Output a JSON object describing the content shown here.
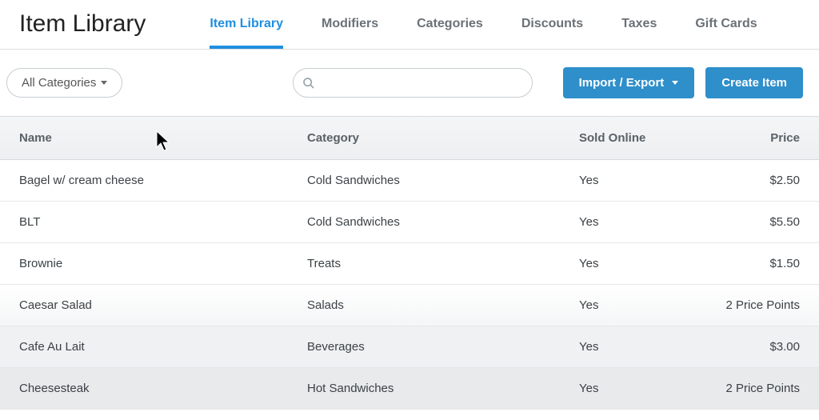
{
  "header": {
    "title": "Item Library",
    "tabs": [
      {
        "label": "Item Library",
        "active": true
      },
      {
        "label": "Modifiers",
        "active": false
      },
      {
        "label": "Categories",
        "active": false
      },
      {
        "label": "Discounts",
        "active": false
      },
      {
        "label": "Taxes",
        "active": false
      },
      {
        "label": "Gift Cards",
        "active": false
      }
    ]
  },
  "toolbar": {
    "filter_label": "All Categories",
    "search_placeholder": "",
    "import_export_label": "Import / Export",
    "create_label": "Create Item"
  },
  "table": {
    "columns": {
      "name": "Name",
      "category": "Category",
      "sold_online": "Sold Online",
      "price": "Price"
    },
    "rows": [
      {
        "name": "Bagel w/ cream cheese",
        "category": "Cold Sandwiches",
        "sold_online": "Yes",
        "price": "$2.50"
      },
      {
        "name": "BLT",
        "category": "Cold Sandwiches",
        "sold_online": "Yes",
        "price": "$5.50"
      },
      {
        "name": "Brownie",
        "category": "Treats",
        "sold_online": "Yes",
        "price": "$1.50"
      },
      {
        "name": "Caesar Salad",
        "category": "Salads",
        "sold_online": "Yes",
        "price": "2 Price Points"
      },
      {
        "name": "Cafe Au Lait",
        "category": "Beverages",
        "sold_online": "Yes",
        "price": "$3.00"
      },
      {
        "name": "Cheesesteak",
        "category": "Hot Sandwiches",
        "sold_online": "Yes",
        "price": "2 Price Points"
      }
    ]
  },
  "colors": {
    "accent": "#1f8fe0",
    "button": "#2e8fcb"
  }
}
